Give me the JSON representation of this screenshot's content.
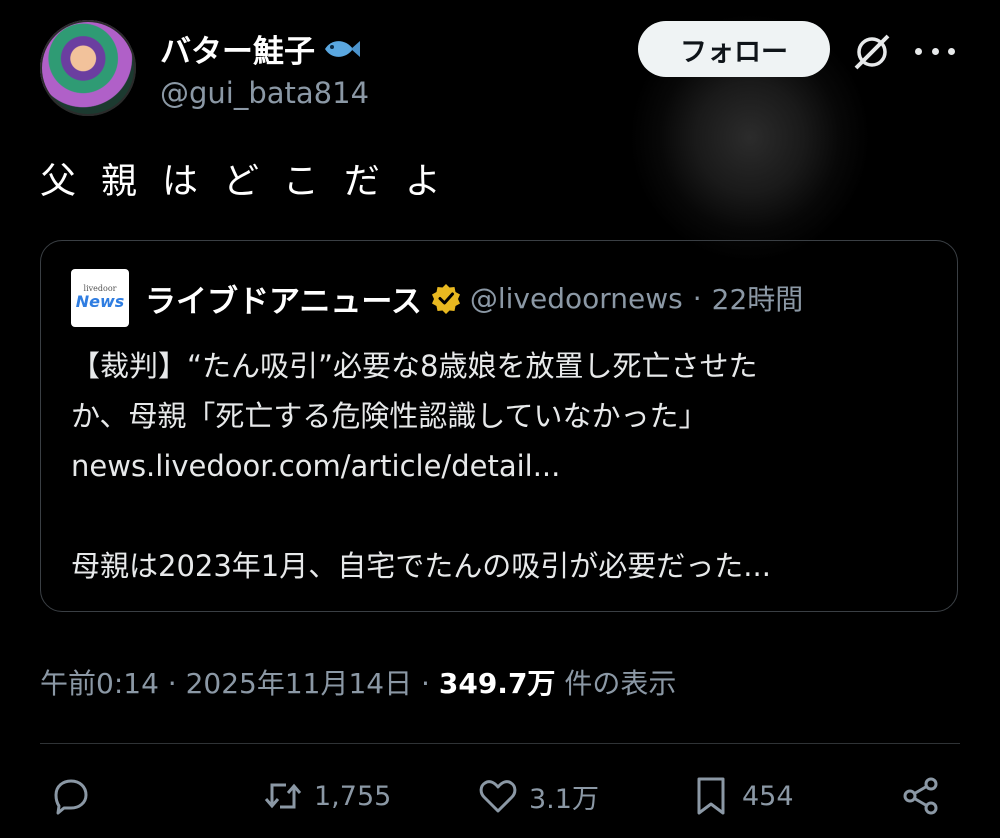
{
  "author": {
    "display_name": "バター鮭子",
    "handle": "@gui_bata814",
    "name_emoji_icon": "fish-icon"
  },
  "header": {
    "follow_label": "フォロー",
    "grok_icon": "grok-icon",
    "more_icon": "more-icon"
  },
  "tweet": {
    "text": "父親はどこだよ"
  },
  "quote": {
    "source_logo_small": "livedoor",
    "source_logo_main": "News",
    "name": "ライブドアニュース",
    "verified_icon": "verified-badge-icon",
    "handle": "@livedoornews",
    "separator": "·",
    "time": "22時間",
    "lines": [
      "【裁判】“たん吸引”必要な8歳娘を放置し死亡させた",
      "か、母親「死亡する危険性認識していなかった」",
      "news.livedoor.com/article/detail...",
      "母親は2023年1月、自宅でたんの吸引が必要だった..."
    ]
  },
  "meta": {
    "time": "午前0:14",
    "sep1": "·",
    "date": "2025年11月14日",
    "sep2": "·",
    "views": "349.7万",
    "views_suffix": "件の表示"
  },
  "actions": {
    "reply": {
      "icon": "reply-icon",
      "count": ""
    },
    "retweet": {
      "icon": "retweet-icon",
      "count": "1,755"
    },
    "like": {
      "icon": "heart-icon",
      "count": "3.1万"
    },
    "bookmark": {
      "icon": "bookmark-icon",
      "count": "454"
    },
    "share": {
      "icon": "share-icon"
    }
  },
  "colors": {
    "background": "#000000",
    "text": "#e7e9ea",
    "secondary": "#8b98a5",
    "verified": "#e8b820"
  }
}
